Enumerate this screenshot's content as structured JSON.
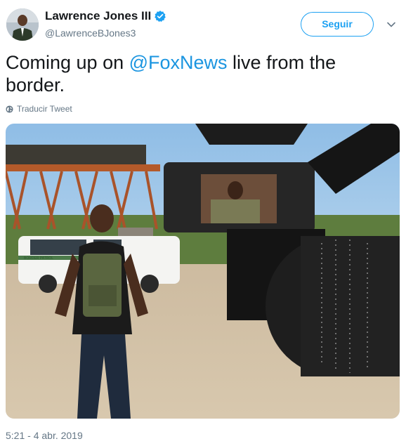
{
  "author": {
    "name": "Lawrence Jones III",
    "handle": "@LawrenceBJones3",
    "verified": true
  },
  "follow_label": "Seguir",
  "tweet": {
    "text_before": "Coming up on ",
    "mention": "@FoxNews",
    "text_after": " live from the border."
  },
  "translate_label": "Traducir Tweet",
  "media": {
    "vehicle_text": "BORDER PATROL",
    "subject": "man in black shirt and tactical vest standing on dirt lot, camera rig in foreground"
  },
  "timestamp": "5:21 - 4 abr. 2019",
  "colors": {
    "accent": "#1da1f2",
    "link": "#1b95e0",
    "muted": "#657786"
  },
  "icons": [
    "verified-badge-icon",
    "chevron-down-icon",
    "globe-icon"
  ]
}
